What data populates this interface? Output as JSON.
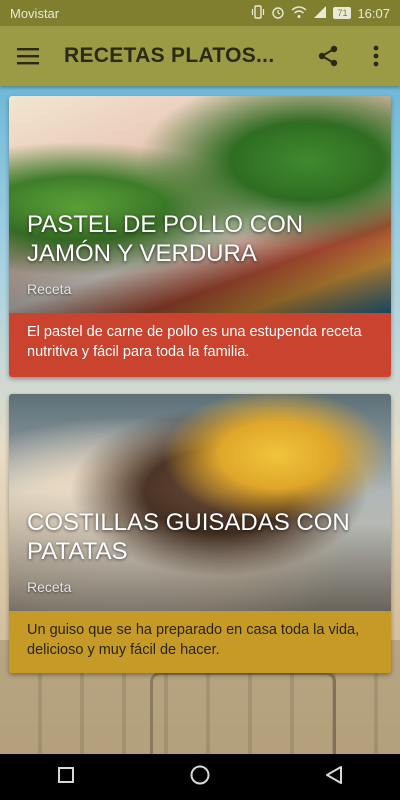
{
  "status_bar": {
    "carrier": "Movistar",
    "battery": "71",
    "time": "16:07"
  },
  "app_bar": {
    "title": "RECETAS PLATOS...",
    "icons": [
      "menu-icon",
      "share-icon",
      "more-vert-icon"
    ]
  },
  "cards": [
    {
      "title": "PASTEL DE POLLO CON JAMÓN Y VERDURA",
      "subtitle": "Receta",
      "description": "El pastel de carne de pollo es una estupenda receta nutritiva y fácil para toda la familia.",
      "accent_color": "#c9432e"
    },
    {
      "title": "COSTILLAS GUISADAS CON PATATAS",
      "subtitle": "Receta",
      "description": "Un guiso que se ha preparado en casa toda la vida, delicioso y muy fácil de hacer.",
      "accent_color": "#c69a26"
    }
  ],
  "nav_bar": {
    "icons": [
      "recents-icon",
      "home-icon",
      "back-icon"
    ]
  },
  "colors": {
    "status_bar": "#7f7f2f",
    "app_bar": "#9b9b46"
  }
}
